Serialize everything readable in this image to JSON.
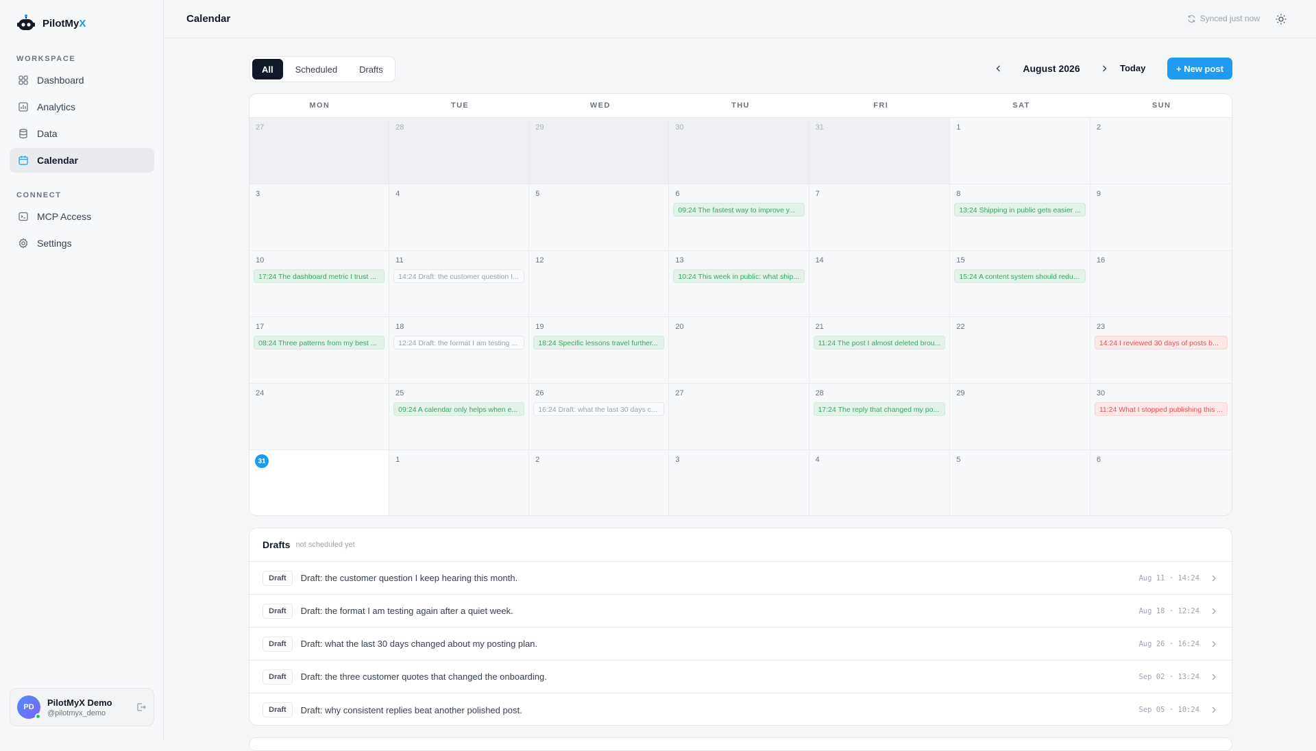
{
  "brand": {
    "name_main": "PilotMy",
    "name_accent": "X",
    "accent_color": "#1d9bf0"
  },
  "sidebar": {
    "workspace_label": "WORKSPACE",
    "connect_label": "CONNECT",
    "items": [
      {
        "label": "Dashboard",
        "icon": "grid-icon"
      },
      {
        "label": "Analytics",
        "icon": "chart-icon"
      },
      {
        "label": "Data",
        "icon": "database-icon"
      },
      {
        "label": "Calendar",
        "icon": "calendar-icon",
        "active": true
      },
      {
        "label": "MCP Access",
        "icon": "terminal-icon"
      },
      {
        "label": "Settings",
        "icon": "gear-icon"
      }
    ],
    "user": {
      "initials": "PD",
      "name": "PilotMyX Demo",
      "handle": "@pilotmyx_demo"
    }
  },
  "topbar": {
    "title": "Calendar",
    "sync_status": "Synced just now"
  },
  "toolbar": {
    "filters": [
      "All",
      "Scheduled",
      "Drafts"
    ],
    "active_filter": "All",
    "month": "August 2026",
    "today_label": "Today",
    "new_post_label": "+ New post"
  },
  "calendar": {
    "weekdays": [
      "MON",
      "TUE",
      "WED",
      "THU",
      "FRI",
      "SAT",
      "SUN"
    ],
    "cells": [
      {
        "day": "27",
        "out": true,
        "events": []
      },
      {
        "day": "28",
        "out": true,
        "events": []
      },
      {
        "day": "29",
        "out": true,
        "events": []
      },
      {
        "day": "30",
        "out": true,
        "events": []
      },
      {
        "day": "31",
        "out": true,
        "events": []
      },
      {
        "day": "1",
        "events": []
      },
      {
        "day": "2",
        "events": []
      },
      {
        "day": "3",
        "events": []
      },
      {
        "day": "4",
        "events": []
      },
      {
        "day": "5",
        "events": []
      },
      {
        "day": "6",
        "events": [
          {
            "text": "09:24 The fastest way to improve y...",
            "status": "scheduled"
          }
        ]
      },
      {
        "day": "7",
        "events": []
      },
      {
        "day": "8",
        "events": [
          {
            "text": "13:24 Shipping in public gets easier ...",
            "status": "scheduled"
          }
        ]
      },
      {
        "day": "9",
        "events": []
      },
      {
        "day": "10",
        "events": [
          {
            "text": "17:24 The dashboard metric I trust ...",
            "status": "scheduled"
          }
        ]
      },
      {
        "day": "11",
        "events": [
          {
            "text": "14:24 Draft: the customer question I...",
            "status": "draft"
          }
        ]
      },
      {
        "day": "12",
        "events": []
      },
      {
        "day": "13",
        "events": [
          {
            "text": "10:24 This week in public: what ship...",
            "status": "scheduled"
          }
        ]
      },
      {
        "day": "14",
        "events": []
      },
      {
        "day": "15",
        "events": [
          {
            "text": "15:24 A content system should redu...",
            "status": "scheduled"
          }
        ]
      },
      {
        "day": "16",
        "events": []
      },
      {
        "day": "17",
        "events": [
          {
            "text": "08:24 Three patterns from my best ...",
            "status": "scheduled"
          }
        ]
      },
      {
        "day": "18",
        "events": [
          {
            "text": "12:24 Draft: the format I am testing ...",
            "status": "draft"
          }
        ]
      },
      {
        "day": "19",
        "events": [
          {
            "text": "18:24 Specific lessons travel further...",
            "status": "scheduled"
          }
        ]
      },
      {
        "day": "20",
        "events": []
      },
      {
        "day": "21",
        "events": [
          {
            "text": "11:24 The post I almost deleted brou...",
            "status": "scheduled"
          }
        ]
      },
      {
        "day": "22",
        "events": []
      },
      {
        "day": "23",
        "events": [
          {
            "text": "14:24 I reviewed 30 days of posts b...",
            "status": "failed"
          }
        ]
      },
      {
        "day": "24",
        "events": []
      },
      {
        "day": "25",
        "events": [
          {
            "text": "09:24 A calendar only helps when e...",
            "status": "scheduled"
          }
        ]
      },
      {
        "day": "26",
        "events": [
          {
            "text": "16:24 Draft: what the last 30 days c...",
            "status": "draft"
          }
        ]
      },
      {
        "day": "27",
        "events": []
      },
      {
        "day": "28",
        "events": [
          {
            "text": "17:24 The reply that changed my po...",
            "status": "scheduled"
          }
        ]
      },
      {
        "day": "29",
        "events": []
      },
      {
        "day": "30",
        "events": [
          {
            "text": "11:24 What I stopped publishing this ...",
            "status": "failed"
          }
        ]
      },
      {
        "day": "31",
        "today": true,
        "events": []
      },
      {
        "day": "1",
        "events": []
      },
      {
        "day": "2",
        "events": []
      },
      {
        "day": "3",
        "events": []
      },
      {
        "day": "4",
        "events": []
      },
      {
        "day": "5",
        "events": []
      },
      {
        "day": "6",
        "events": []
      }
    ]
  },
  "drafts": {
    "title": "Drafts",
    "subtitle": "not scheduled yet",
    "pill": "Draft",
    "rows": [
      {
        "text": "Draft: the customer question I keep hearing this month.",
        "date": "Aug 11 · 14:24"
      },
      {
        "text": "Draft: the format I am testing again after a quiet week.",
        "date": "Aug 18 · 12:24"
      },
      {
        "text": "Draft: what the last 30 days changed about my posting plan.",
        "date": "Aug 26 · 16:24"
      },
      {
        "text": "Draft: the three customer quotes that changed the onboarding.",
        "date": "Sep 02 · 13:24"
      },
      {
        "text": "Draft: why consistent replies beat another polished post.",
        "date": "Sep 05 · 10:24"
      }
    ]
  }
}
